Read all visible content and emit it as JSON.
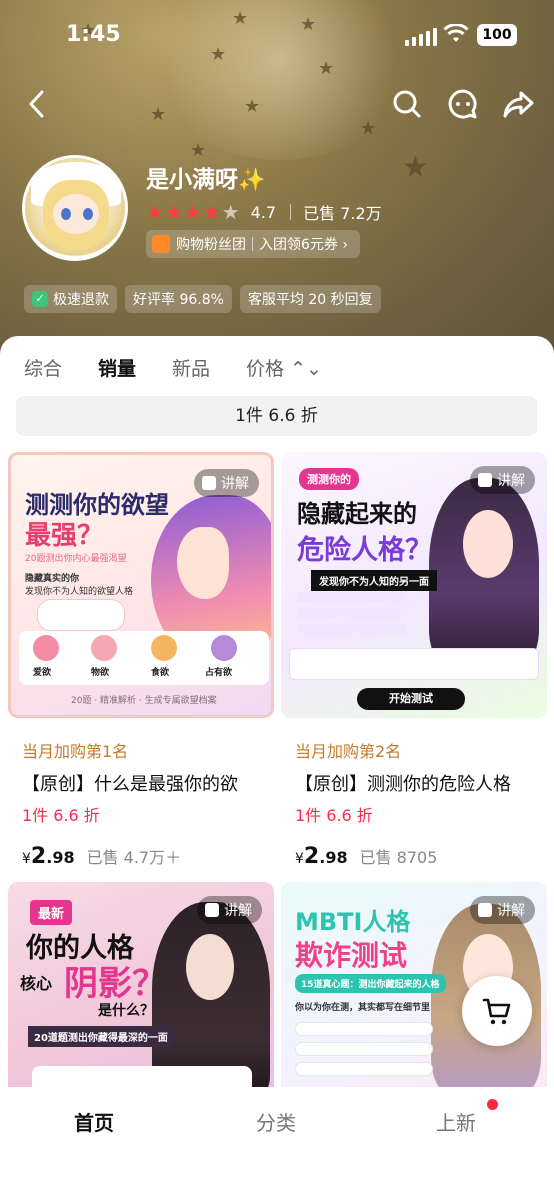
{
  "status_bar": {
    "time": "1:45",
    "battery": "100"
  },
  "shop": {
    "name": "是小满呀",
    "name_sparkle": "✨",
    "rating_stars": 4.7,
    "rating_score": "4.7",
    "sold": "已售 7.2万",
    "fans_text": "购物粉丝团",
    "fans_offer": "入团领6元券 ›"
  },
  "badges": [
    {
      "label": "极速退款"
    },
    {
      "label": "好评率 96.8%"
    },
    {
      "label": "客服平均 20 秒回复"
    }
  ],
  "tabs": [
    {
      "label": "综合"
    },
    {
      "label": "销量"
    },
    {
      "label": "新品"
    },
    {
      "label": "价格 ⌃⌄"
    }
  ],
  "promo_bar": "1件 6.6 折",
  "products": [
    {
      "explain": "讲解",
      "rank": "当月加购第1名",
      "title": "【原创】什么是最强你的欲",
      "discount": "1件 6.6 折",
      "currency": "¥",
      "price_int": "2",
      "price_dec": ".98",
      "sold": "已售 4.7万＋",
      "art": {
        "line1": "测测你的欲望",
        "line2": "最强？",
        "sub": "20题测出你内心最强渴望",
        "desc1": "隐藏真实的你",
        "desc2": "发现你不为人知的欲望人格",
        "chips": [
          "爱欲",
          "物欲",
          "食欲",
          "占有欲"
        ],
        "footer": "20题 · 精准解析 · 生成专属欲望档案"
      }
    },
    {
      "explain": "讲解",
      "rank": "当月加购第2名",
      "title": "【原创】测测你的危险人格",
      "discount": "1件 6.6 折",
      "currency": "¥",
      "price_int": "2",
      "price_dec": ".98",
      "sold": "已售 8705",
      "art": {
        "tag": "测测你的",
        "line1": "隐藏起来的",
        "line2": "危险人格？",
        "sub": "发现你不为人知的另一面",
        "cta": "开始测试"
      }
    },
    {
      "explain": "讲解",
      "art": {
        "tag": "最新",
        "line1": "你的人格",
        "line2": "核心",
        "line3": "阴影？",
        "line4": "是什么？",
        "sub": "20道题测出你藏得最深的一面"
      }
    },
    {
      "explain": "讲解",
      "art": {
        "line1": "MBTI人格",
        "line2": "欺诈测试",
        "sub": "15道真心题：测出你藏起来的人格",
        "q": "你以为你在测，其实都写在细节里"
      }
    }
  ],
  "bottom_nav": [
    {
      "label": "首页"
    },
    {
      "label": "分类"
    },
    {
      "label": "上新"
    }
  ],
  "colors": {
    "accent_red": "#ff2b4a",
    "rank_gold": "#c47a2a",
    "star_red": "#ff3b3b"
  }
}
